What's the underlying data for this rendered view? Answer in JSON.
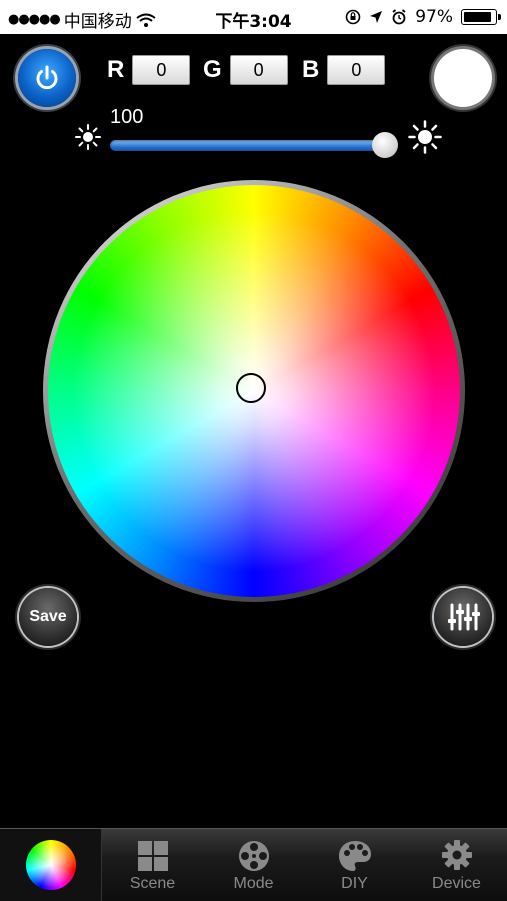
{
  "status_bar": {
    "carrier": "中国移动",
    "time": "下午3:04",
    "battery": "97%",
    "battery_level": 0.97
  },
  "controls": {
    "r_label": "R",
    "r_value": "0",
    "g_label": "G",
    "g_value": "0",
    "b_label": "B",
    "b_value": "0",
    "brightness_value": "100",
    "brightness_level": 1.0,
    "selected_color": "#ffffff"
  },
  "buttons": {
    "save_label": "Save"
  },
  "tabs": [
    {
      "label": "",
      "active": true
    },
    {
      "label": "Scene"
    },
    {
      "label": "Mode"
    },
    {
      "label": "DIY"
    },
    {
      "label": "Device"
    }
  ],
  "colors": {
    "power_accent": "#1a7fe8",
    "slider_fill": "#2a74d4"
  }
}
